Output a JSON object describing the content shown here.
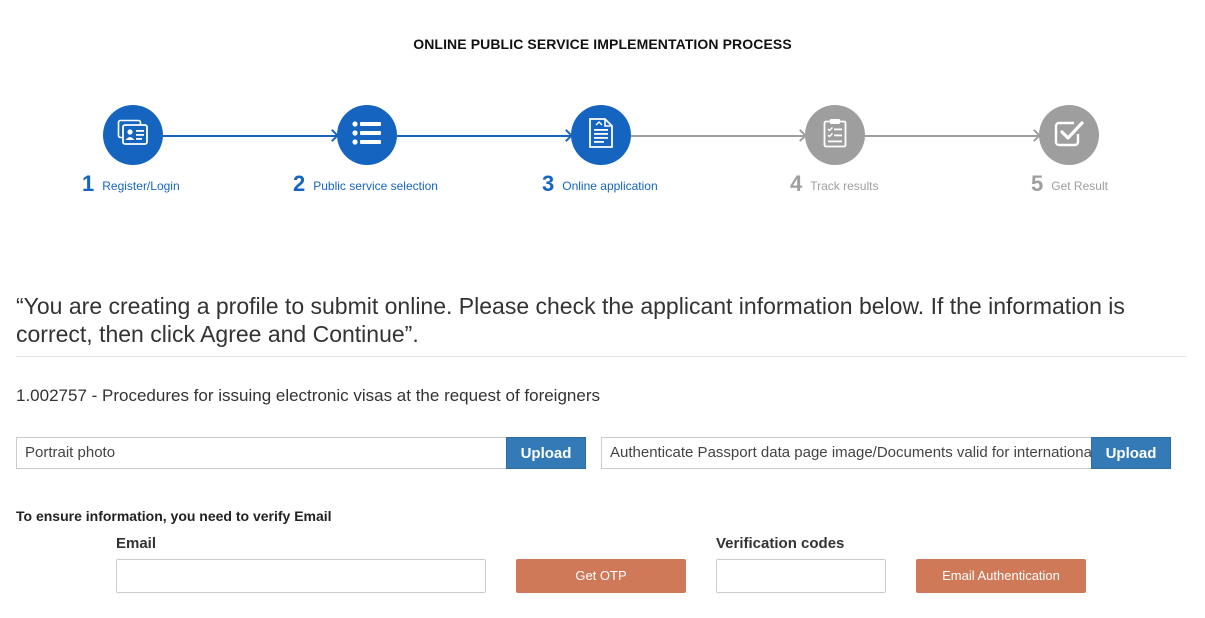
{
  "header": {
    "title": "ONLINE PUBLIC SERVICE IMPLEMENTATION PROCESS"
  },
  "colors": {
    "active": "#1565c0",
    "inactive": "#9e9e9e",
    "upload_button": "#337ab7",
    "action_button": "#cf7958"
  },
  "steps": [
    {
      "number": "1",
      "label": "Register/Login",
      "icon": "id-card-icon",
      "state": "active"
    },
    {
      "number": "2",
      "label": "Public service selection",
      "icon": "list-icon",
      "state": "active"
    },
    {
      "number": "3",
      "label": "Online application",
      "icon": "document-icon",
      "state": "active"
    },
    {
      "number": "4",
      "label": "Track results",
      "icon": "clipboard-checklist-icon",
      "state": "inactive"
    },
    {
      "number": "5",
      "label": "Get Result",
      "icon": "check-square-icon",
      "state": "inactive"
    }
  ],
  "notice": "“You are creating a profile to submit online. Please check the applicant information below. If the information is correct, then click Agree and Continue”.",
  "procedure": "1.002757 - Procedures for issuing electronic visas at the request of foreigners",
  "uploads": {
    "portrait": {
      "label": "Portrait photo",
      "button": "Upload"
    },
    "passport": {
      "label": "Authenticate Passport data page image/Documents valid for international travel",
      "button": "Upload"
    }
  },
  "verify": {
    "title": "To ensure information, you need to verify Email",
    "email_label": "Email",
    "email_value": "",
    "otp_button": "Get OTP",
    "code_label": "Verification codes",
    "code_value": "",
    "auth_button": "Email Authentication"
  }
}
